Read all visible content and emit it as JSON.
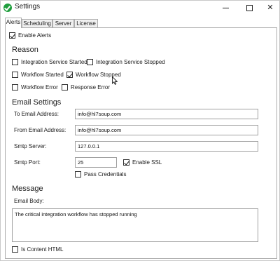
{
  "window": {
    "title": "Settings"
  },
  "tabs": [
    {
      "label": "Alerts"
    },
    {
      "label": "Scheduling"
    },
    {
      "label": "Server"
    },
    {
      "label": "License"
    }
  ],
  "enable_alerts": {
    "label": "Enable Alerts",
    "checked": true
  },
  "reason": {
    "heading": "Reason",
    "options": [
      {
        "label": "Integration Service Started",
        "checked": false
      },
      {
        "label": "Integration Service Stopped",
        "checked": false
      },
      {
        "label": "Workflow Started",
        "checked": false
      },
      {
        "label": "Workflow Stopped",
        "checked": true
      },
      {
        "label": "Workflow Error",
        "checked": false
      },
      {
        "label": "Response Error",
        "checked": false
      }
    ]
  },
  "email": {
    "heading": "Email Settings",
    "to_label": "To Email Address:",
    "to_value": "info@hl7soup.com",
    "from_label": "From Email Address:",
    "from_value": "info@hl7soup.com",
    "smtp_server_label": "Smtp Server:",
    "smtp_server_value": "127.0.0.1",
    "smtp_port_label": "Smtp Port:",
    "smtp_port_value": "25",
    "enable_ssl_label": "Enable SSL",
    "enable_ssl_checked": true,
    "pass_credentials_label": "Pass Credentials",
    "pass_credentials_checked": false
  },
  "message": {
    "heading": "Message",
    "body_label": "Email Body:",
    "body_value": "The critical integration workflow has stopped running",
    "is_html_label": "Is Content HTML",
    "is_html_checked": false
  },
  "colors": {
    "app_icon": "#1f9e3d",
    "border": "#adadad"
  }
}
